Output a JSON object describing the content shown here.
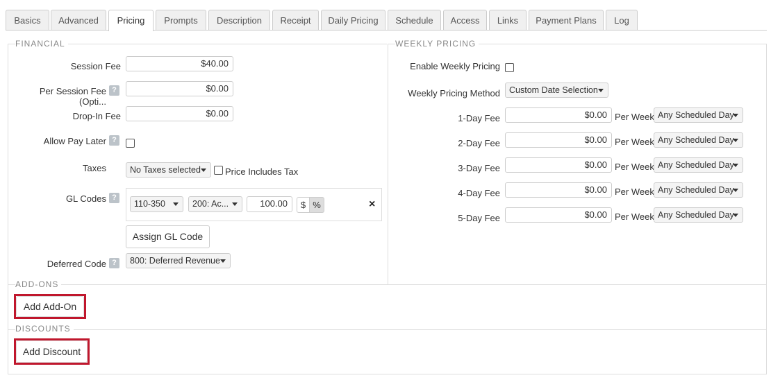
{
  "tabs": [
    "Basics",
    "Advanced",
    "Pricing",
    "Prompts",
    "Description",
    "Receipt",
    "Daily Pricing",
    "Schedule",
    "Access",
    "Links",
    "Payment Plans",
    "Log"
  ],
  "active_tab": "Pricing",
  "financial": {
    "legend": "FINANCIAL",
    "session_fee_label": "Session Fee",
    "session_fee_value": "$40.00",
    "per_session_label": "Per Session Fee (Opti...",
    "per_session_value": "$0.00",
    "dropin_label": "Drop-In Fee",
    "dropin_value": "$0.00",
    "pay_later_label": "Allow Pay Later",
    "taxes_label": "Taxes",
    "taxes_select": "No Taxes selected",
    "price_includes_tax": "Price Includes Tax",
    "gl_codes_label": "GL Codes",
    "gl_code_select": "110-350",
    "gl_account_select": "200: Ac...",
    "gl_amount": "100.00",
    "dollar_toggle": "$",
    "percent_toggle": "%",
    "remove_icon": "×",
    "assign_gl_button": "Assign GL Code",
    "deferred_label": "Deferred Code",
    "deferred_select": "800: Deferred Revenue",
    "help_glyph": "?"
  },
  "weekly": {
    "legend": "WEEKLY PRICING",
    "enable_label": "Enable Weekly Pricing",
    "method_label": "Weekly Pricing Method",
    "method_select": "Custom Date Selection",
    "rows": [
      {
        "label": "1-Day Fee",
        "value": "$0.00",
        "per": "Per Week",
        "select": "Any Scheduled Day"
      },
      {
        "label": "2-Day Fee",
        "value": "$0.00",
        "per": "Per Week",
        "select": "Any Scheduled Day"
      },
      {
        "label": "3-Day Fee",
        "value": "$0.00",
        "per": "Per Week",
        "select": "Any Scheduled Day"
      },
      {
        "label": "4-Day Fee",
        "value": "$0.00",
        "per": "Per Week",
        "select": "Any Scheduled Day"
      },
      {
        "label": "5-Day Fee",
        "value": "$0.00",
        "per": "Per Week",
        "select": "Any Scheduled Day"
      }
    ]
  },
  "addons": {
    "legend": "ADD-ONS",
    "button": "Add Add-On"
  },
  "discounts": {
    "legend": "DISCOUNTS",
    "button": "Add Discount"
  },
  "colors": {
    "highlight": "#c0172d",
    "border": "#cccccc",
    "help_badge": "#bcc3c9"
  }
}
